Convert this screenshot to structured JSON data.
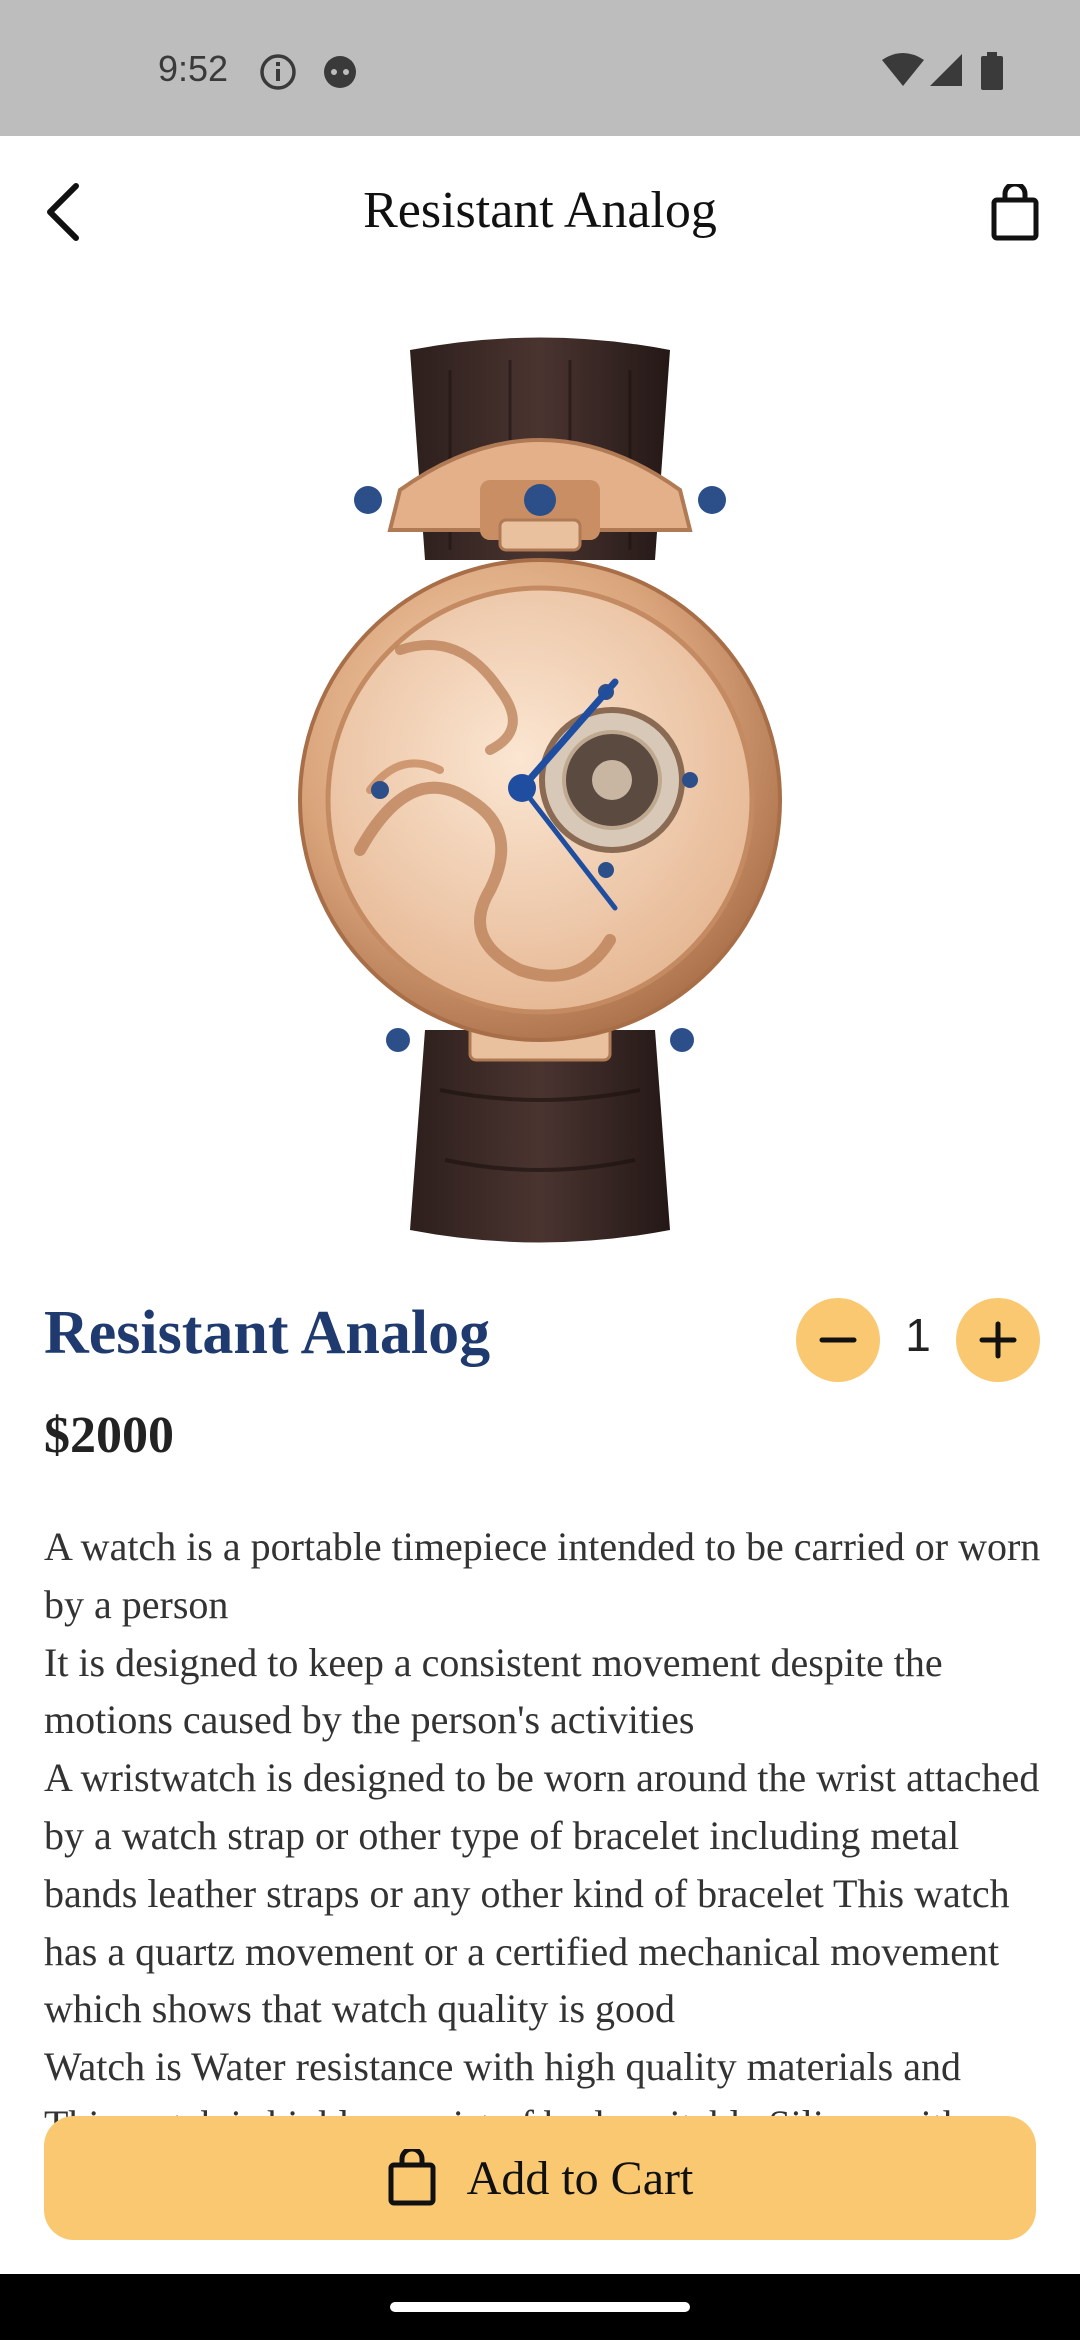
{
  "status_bar": {
    "time": "9:52"
  },
  "app_bar": {
    "title": "Resistant Analog"
  },
  "product": {
    "name": "Resistant Analog",
    "price": "$2000",
    "quantity": "1",
    "description": "A watch is a portable timepiece intended to be carried or worn by a person\nIt is designed to keep a consistent movement despite the motions caused by the person's activities\nA wristwatch is designed to be worn around the wrist attached by a watch strap or other type of bracelet including metal bands leather straps or any other kind of bracelet This watch has a quartz movement or a certified mechanical movement which shows that watch quality is good\nWatch is Water resistance with high quality materials and\nThis watch is highly consist of body suitable Silicon with"
  },
  "actions": {
    "add_to_cart_label": "Add to Cart"
  },
  "colors": {
    "accent": "#fac870",
    "title_blue": "#1f3a6e",
    "status_bar": "#bdbdbd"
  }
}
